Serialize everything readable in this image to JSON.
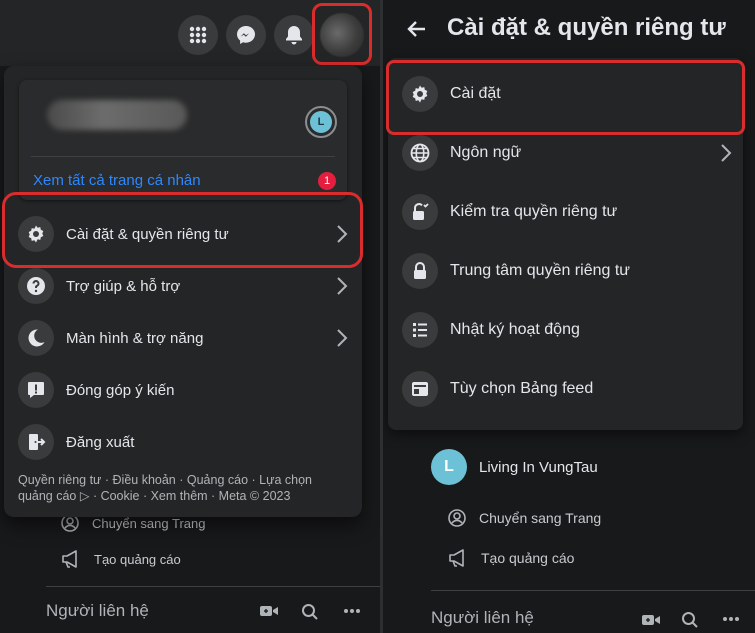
{
  "left": {
    "topbar": {
      "icons": [
        "apps-grid-icon",
        "messenger-icon",
        "notifications-bell-icon",
        "profile-avatar"
      ]
    },
    "profile_card": {
      "avatar_letter": "L",
      "see_all_label": "Xem tất cả trang cá nhân",
      "notification_count": "1"
    },
    "menu_items": [
      {
        "label": "Cài đặt & quyền riêng tư",
        "icon": "gear-icon",
        "has_chevron": true
      },
      {
        "label": "Trợ giúp & hỗ trợ",
        "icon": "question-icon",
        "has_chevron": true
      },
      {
        "label": "Màn hình & trợ năng",
        "icon": "moon-icon",
        "has_chevron": true
      },
      {
        "label": "Đóng góp ý kiến",
        "icon": "feedback-icon",
        "has_chevron": false
      },
      {
        "label": "Đăng xuất",
        "icon": "logout-icon",
        "has_chevron": false
      }
    ],
    "footer": "Quyền riêng tư · Điều khoản · Quảng cáo · Lựa chọn quảng cáo ▷ · Cookie · Xem thêm · Meta © 2023",
    "sidebar": {
      "switch_page": "Chuyển sang Trang",
      "create_ad": "Tạo quảng cáo",
      "contacts": "Người liên hệ"
    }
  },
  "right": {
    "title": "Cài đặt & quyền riêng tư",
    "items": [
      {
        "label": "Cài đặt",
        "icon": "gear-icon"
      },
      {
        "label": "Ngôn ngữ",
        "icon": "globe-icon"
      },
      {
        "label": "Kiểm tra quyền riêng tư",
        "icon": "lock-check-icon"
      },
      {
        "label": "Trung tâm quyền riêng tư",
        "icon": "lock-icon"
      },
      {
        "label": "Nhật ký hoạt động",
        "icon": "list-icon"
      },
      {
        "label": "Tùy chọn Bảng feed",
        "icon": "feed-icon"
      }
    ],
    "page_name": "Living In VungTau",
    "page_avatar_letter": "L",
    "switch_page": "Chuyển sang Trang",
    "create_ad": "Tạo quảng cáo",
    "contacts": "Người liên hệ"
  },
  "colors": {
    "highlight": "#d92c2c",
    "link": "#2d88ff",
    "badge": "#e41e3f",
    "avatar": "#6cc1d6"
  }
}
